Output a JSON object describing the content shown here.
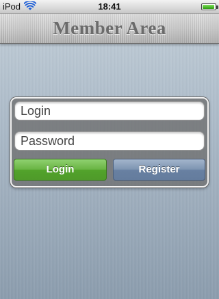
{
  "status_bar": {
    "carrier": "iPod",
    "time": "18:41",
    "battery_level": 0.95
  },
  "header": {
    "title": "Member Area"
  },
  "login_form": {
    "login_placeholder": "Login",
    "login_value": "",
    "password_placeholder": "Password",
    "password_value": "",
    "login_button": "Login",
    "register_button": "Register"
  },
  "colors": {
    "login_button": "#6ab544",
    "register_button": "#7e95b2",
    "header_title": "#6b6b6b"
  },
  "icons": [
    "wifi-icon",
    "battery-icon"
  ]
}
